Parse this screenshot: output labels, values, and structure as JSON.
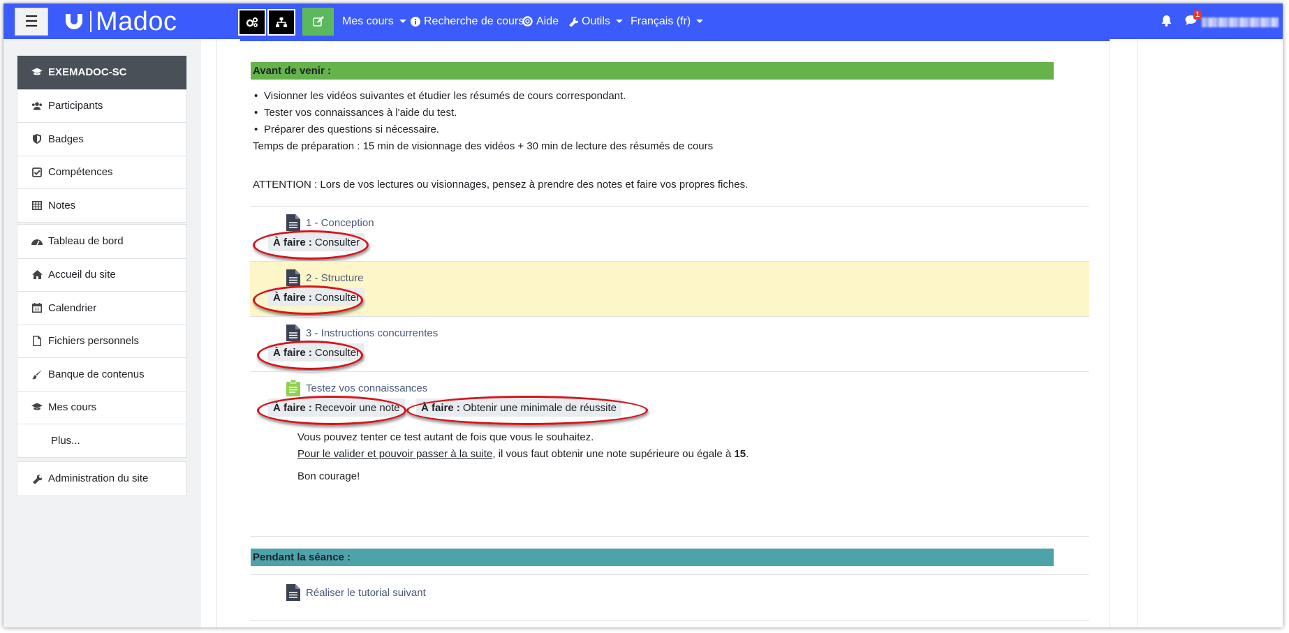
{
  "navbar": {
    "brand": "Madoc",
    "menu": {
      "my_courses": "Mes cours",
      "course_search": "Recherche de cours",
      "help": "Aide",
      "tools": "Outils",
      "language": "Français (fr)"
    },
    "notification_count": "1"
  },
  "drawer": {
    "course_short": "EXEMADOC-SC",
    "course_items": [
      "Participants",
      "Badges",
      "Compétences",
      "Notes"
    ],
    "site_items": [
      "Tableau de bord",
      "Accueil du site",
      "Calendrier",
      "Fichiers personnels",
      "Banque de contenus",
      "Mes cours",
      "Plus..."
    ],
    "admin_item": "Administration du site"
  },
  "content": {
    "before_header": "Avant de venir :",
    "bullets": [
      "Visionner les vidéos suivantes et étudier les résumés de cours correspondant.",
      "Tester vos connaissances à l'aide du test.",
      "Préparer des questions si nécessaire."
    ],
    "prep_time": "Temps de préparation : 15 min de visionnage des vidéos + 30 min de lecture des résumés de cours",
    "attention": "ATTENTION : Lors de vos lectures ou visionnages, pensez à prendre des notes et faire vos propres fiches.",
    "todo_label": "À faire :",
    "activities": [
      {
        "title": "1 - Conception",
        "todo": "Consulter"
      },
      {
        "title": "2 - Structure",
        "todo": "Consulter"
      },
      {
        "title": "3 - Instructions concurrentes",
        "todo": "Consulter"
      }
    ],
    "quiz": {
      "title": "Testez vos connaissances",
      "todo1": "Recevoir une note",
      "todo2": "Obtenir une minimale de réussite",
      "line1": "Vous pouvez tenter ce test autant de fois que vous le souhaitez.",
      "line2_link": "Pour le valider et pouvoir passer à la suite",
      "line2_rest": ", il vous faut obtenir une note supérieure ou égale à ",
      "line2_score": "15",
      "line2_end": ".",
      "line3": "Bon courage!"
    },
    "during_header": "Pendant la séance :",
    "tutorial": "Réaliser le tutorial suivant"
  },
  "colors": {
    "navbar": "#3b5bfd",
    "green_header": "#65b34a",
    "teal_header": "#4ea3ab",
    "highlight": "#fdf6c8",
    "annotation_red": "#d8131b"
  }
}
